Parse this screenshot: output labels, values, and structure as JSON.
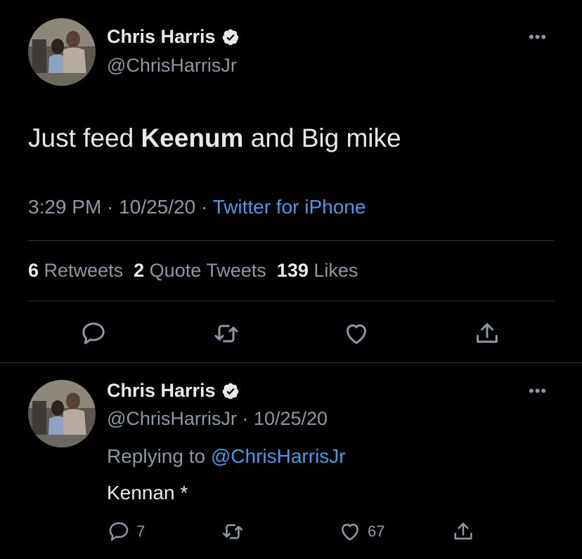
{
  "main_tweet": {
    "author": {
      "name": "Chris Harris",
      "handle": "@ChrisHarrisJr",
      "verified": true
    },
    "text": {
      "before": "Just feed",
      "bold": "Keenum",
      "after": "and Big mike"
    },
    "time": "3:29 PM",
    "date": "10/25/20",
    "source": "Twitter for iPhone",
    "separator": "·",
    "stats": {
      "retweets_count": "6",
      "retweets_label": "Retweets",
      "quotes_count": "2",
      "quotes_label": "Quote Tweets",
      "likes_count": "139",
      "likes_label": "Likes"
    },
    "more_label": "•••"
  },
  "reply_tweet": {
    "author": {
      "name": "Chris Harris",
      "handle": "@ChrisHarrisJr",
      "verified": true
    },
    "date": "10/25/20",
    "separator": "·",
    "replying_prefix": "Replying to",
    "replying_to": "@ChrisHarrisJr",
    "text": "Kennan *",
    "reply_count": "7",
    "retweet_count": "",
    "like_count": "67",
    "more_label": "•••"
  },
  "colors": {
    "background": "#000000",
    "text": "#e7e9ea",
    "muted": "#8b98a5",
    "link": "#4a99e9",
    "divider": "#2f3336"
  },
  "icons": [
    "verified-badge-icon",
    "more-icon",
    "reply-icon",
    "retweet-icon",
    "like-icon",
    "share-icon"
  ]
}
